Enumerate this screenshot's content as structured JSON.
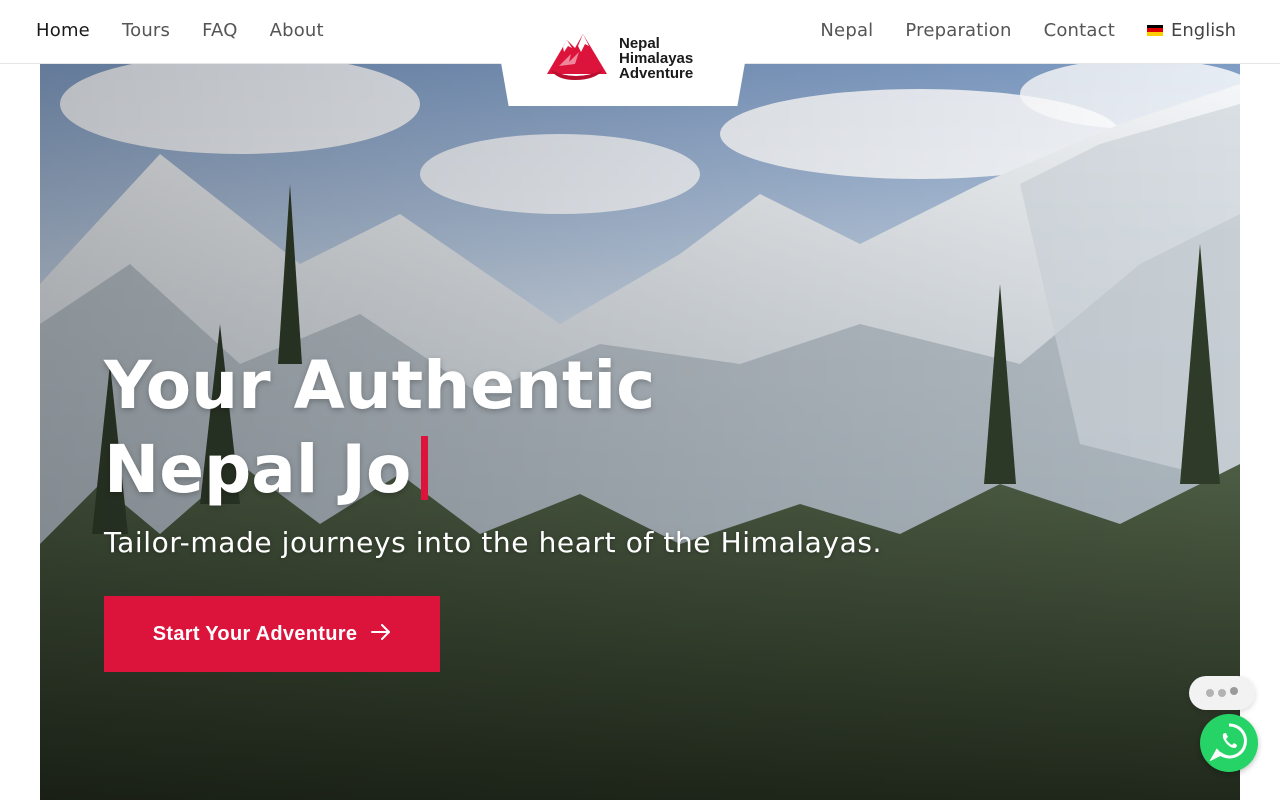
{
  "nav": {
    "left": [
      {
        "label": "Home",
        "active": true
      },
      {
        "label": "Tours"
      },
      {
        "label": "FAQ"
      },
      {
        "label": "About"
      }
    ],
    "right": [
      {
        "label": "Nepal"
      },
      {
        "label": "Preparation"
      },
      {
        "label": "Contact"
      }
    ],
    "language": {
      "label": "English",
      "flag": "german-flag-icon"
    }
  },
  "logo": {
    "line1": "Nepal",
    "line2": "Himalayas",
    "line3": "Adventure",
    "icon": "mountain-logo-icon"
  },
  "hero": {
    "title_line1": "Your Authentic",
    "title_line2": "Nepal Jo",
    "subtitle": "Tailor-made journeys into the heart of the Himalayas.",
    "cta_label": "Start Your Adventure",
    "cta_icon": "arrow-right-icon"
  },
  "widgets": {
    "typing_icon": "typing-dots-icon",
    "whatsapp_icon": "whatsapp-icon"
  },
  "colors": {
    "accent": "#dc143c",
    "whatsapp": "#25d366"
  }
}
